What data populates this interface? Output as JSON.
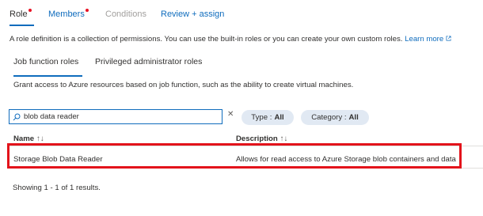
{
  "top_tabs": [
    {
      "label": "Role",
      "state": "active",
      "dot": true
    },
    {
      "label": "Members",
      "state": "link",
      "dot": true
    },
    {
      "label": "Conditions",
      "state": "disabled",
      "dot": false
    },
    {
      "label": "Review + assign",
      "state": "link",
      "dot": false
    }
  ],
  "description": {
    "text": "A role definition is a collection of permissions. You can use the built-in roles or you can create your own custom roles.",
    "link": "Learn more",
    "link_icon": "external-link-icon"
  },
  "sub_tabs": [
    {
      "label": "Job function roles",
      "active": true
    },
    {
      "label": "Privileged administrator roles",
      "active": false
    }
  ],
  "grant_text": "Grant access to Azure resources based on job function, such as the ability to create virtual machines.",
  "search": {
    "value": "blob data reader",
    "icon": "search-icon",
    "clear_icon": "close-icon"
  },
  "filters": [
    {
      "label": "Type :",
      "value": "All"
    },
    {
      "label": "Category :",
      "value": "All"
    }
  ],
  "table": {
    "columns": [
      {
        "label": "Name",
        "sort": "↑↓"
      },
      {
        "label": "Description",
        "sort": "↑↓"
      }
    ],
    "rows": [
      {
        "name": "Storage Blob Data Reader",
        "description": "Allows for read access to Azure Storage blob containers and data"
      }
    ]
  },
  "footer": "Showing 1 - 1 of 1 results.",
  "colors": {
    "accent": "#0f6cbd",
    "highlight": "#e3131b",
    "pill_bg": "#e1e9f3",
    "dot": "#e81123"
  }
}
